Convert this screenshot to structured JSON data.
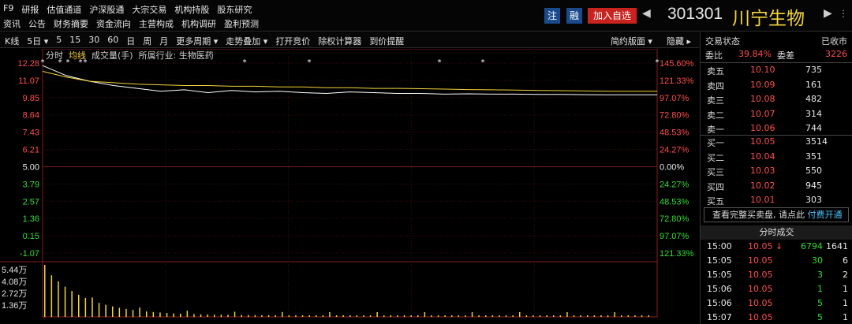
{
  "menu": {
    "row1": [
      "F9",
      "研报",
      "估值通道",
      "沪深股通",
      "大宗交易",
      "机构持股",
      "股东研究"
    ],
    "row2": [
      "资讯",
      "公告",
      "财务摘要",
      "资金流向",
      "主营构成",
      "机构调研",
      "盈利预测"
    ]
  },
  "header": {
    "zhu": "注",
    "rong": "融",
    "add_watch": "加入自选",
    "code": "301301",
    "name": "川宁生物",
    "prev": "◀",
    "next": "▶",
    "more": "⋮"
  },
  "toolbar": {
    "items": [
      "K线",
      "5日 ▾",
      "5",
      "15",
      "30",
      "60",
      "日",
      "周",
      "月",
      "更多周期 ▾",
      "走势叠加 ▾",
      "打开竞价",
      "除权计算器",
      "到价提醒"
    ],
    "right": [
      "简约版面 ▾",
      "隐藏 ▸"
    ]
  },
  "chart_labels": {
    "fenshi": "分时",
    "junxian": "均线",
    "volume": "成交量(手)",
    "industry": "所属行业: 生物医药"
  },
  "y_left": [
    "12.28",
    "11.07",
    "9.85",
    "8.64",
    "7.43",
    "6.21",
    "5.00",
    "3.79",
    "2.57",
    "1.36",
    "0.15",
    "-1.07"
  ],
  "y_right": [
    "145.60%",
    "121.33%",
    "97.07%",
    "72.80%",
    "48.53%",
    "24.27%",
    "0.00%",
    "24.27%",
    "48.53%",
    "72.80%",
    "97.07%",
    "121.33%"
  ],
  "vol_labels": [
    "5.44万",
    "4.08万",
    "2.72万",
    "1.36万"
  ],
  "colors": {
    "up": "#ff4d4d",
    "down": "#33dd33",
    "flat": "#e8e8e8",
    "avg": "#f2d43a",
    "price": "#ffffff"
  },
  "chart_data": {
    "type": "line",
    "title": "",
    "ylim": [
      -1.07,
      12.28
    ],
    "series": [
      {
        "name": "分时",
        "values": [
          12.1,
          11.4,
          11.0,
          10.7,
          10.5,
          10.3,
          10.4,
          10.2,
          10.35,
          10.25,
          10.3,
          10.2,
          10.15,
          10.25,
          10.2,
          10.15,
          10.15,
          10.1,
          10.12,
          10.1,
          10.1,
          10.08,
          10.08,
          10.06,
          10.05,
          10.05,
          10.05
        ]
      },
      {
        "name": "均线",
        "values": [
          11.7,
          11.3,
          11.0,
          10.9,
          10.8,
          10.75,
          10.7,
          10.7,
          10.65,
          10.65,
          10.6,
          10.6,
          10.55,
          10.55,
          10.5,
          10.5,
          10.48,
          10.45,
          10.42,
          10.4,
          10.38,
          10.36,
          10.34,
          10.32,
          10.3,
          10.3,
          10.3
        ]
      }
    ]
  },
  "panel": {
    "status_label": "交易状态",
    "status_value": "已收市",
    "weibi_label": "委比",
    "weibi_value": "39.84%",
    "weicha_label": "委差",
    "weicha_value": "3226",
    "asks": [
      {
        "label": "卖五",
        "price": "10.10",
        "vol": "735"
      },
      {
        "label": "卖四",
        "price": "10.09",
        "vol": "161"
      },
      {
        "label": "卖三",
        "price": "10.08",
        "vol": "482"
      },
      {
        "label": "卖二",
        "price": "10.07",
        "vol": "314"
      },
      {
        "label": "卖一",
        "price": "10.06",
        "vol": "744"
      }
    ],
    "bids": [
      {
        "label": "买一",
        "price": "10.05",
        "vol": "3514"
      },
      {
        "label": "买二",
        "price": "10.04",
        "vol": "351"
      },
      {
        "label": "买三",
        "price": "10.03",
        "vol": "550"
      },
      {
        "label": "买四",
        "price": "10.02",
        "vol": "945"
      },
      {
        "label": "买五",
        "price": "10.01",
        "vol": "303"
      }
    ],
    "notice_text": "查看完整买卖盘, 请点此",
    "notice_pay": "付费开通",
    "ticks_title": "分时成交",
    "ticks": [
      {
        "time": "15:00",
        "price": "10.05 ↓",
        "vol": "6794",
        "num": "1641"
      },
      {
        "time": "15:05",
        "price": "10.05",
        "vol": "30",
        "num": "6"
      },
      {
        "time": "15:05",
        "price": "10.05",
        "vol": "3",
        "num": "2"
      },
      {
        "time": "15:06",
        "price": "10.05",
        "vol": "1",
        "num": "1"
      },
      {
        "time": "15:06",
        "price": "10.05",
        "vol": "5",
        "num": "1"
      },
      {
        "time": "15:07",
        "price": "10.05",
        "vol": "5",
        "num": "1"
      }
    ]
  }
}
